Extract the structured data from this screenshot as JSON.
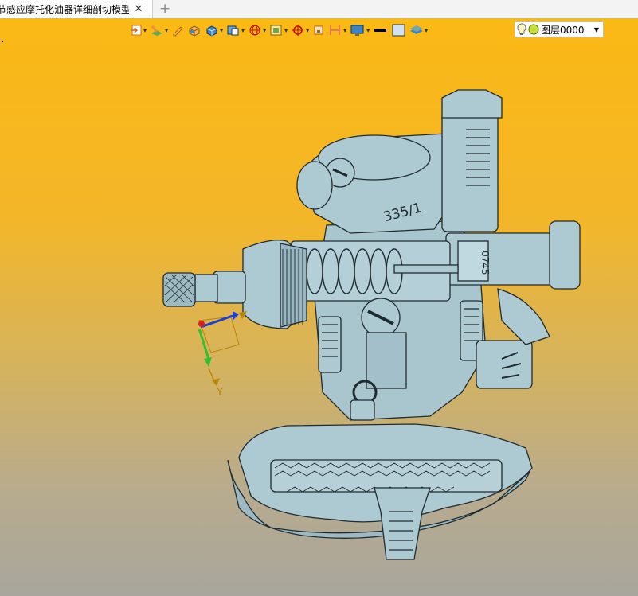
{
  "tab": {
    "title": "节感应摩托化油器详细剖切模型]",
    "close_glyph": "✕",
    "add_glyph": "+"
  },
  "toolbar": {
    "items": [
      {
        "icon": "view-import-icon",
        "caret": true
      },
      {
        "icon": "layer-paint-icon",
        "caret": true
      },
      {
        "icon": "pencil-icon",
        "caret": false
      },
      {
        "icon": "box-shaded-icon",
        "caret": false
      },
      {
        "icon": "cube-blue-icon",
        "caret": true
      },
      {
        "icon": "cube-view-icon",
        "caret": true
      },
      {
        "icon": "sphere-wire-icon",
        "caret": true
      },
      {
        "icon": "frame-view-icon",
        "caret": true
      },
      {
        "icon": "crosshair-icon",
        "caret": true
      },
      {
        "icon": "small-box-icon",
        "caret": false
      },
      {
        "icon": "bracket-icon",
        "caret": true
      },
      {
        "icon": "monitor-icon",
        "caret": true
      },
      {
        "icon": "black-line-icon",
        "caret": false
      },
      {
        "icon": "blue-square-icon",
        "caret": false
      },
      {
        "icon": "layers-stack-icon",
        "caret": true
      }
    ],
    "layer": {
      "label": "图层0000",
      "caret": "▼"
    }
  },
  "model": {
    "text_top": "335/1",
    "text_side": "0745",
    "axis_label": "Y"
  },
  "colors": {
    "part": "#adc9d2",
    "edge": "#1f2b30",
    "bg_top": "#fbb914",
    "bg_bottom": "#a8a69d"
  }
}
